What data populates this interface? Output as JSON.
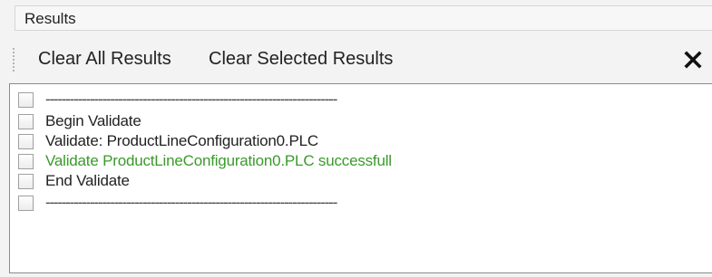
{
  "panel": {
    "title": "Results"
  },
  "toolbar": {
    "clear_all_label": "Clear All Results",
    "clear_selected_label": "Clear Selected Results",
    "close_icon": "close-icon"
  },
  "results": [
    {
      "text": "------------------------------------------------------------------------",
      "kind": "separator",
      "checked": false
    },
    {
      "text": "Begin Validate",
      "kind": "normal",
      "checked": false
    },
    {
      "text": "Validate: ProductLineConfiguration0.PLC",
      "kind": "normal",
      "checked": false
    },
    {
      "text": "Validate ProductLineConfiguration0.PLC successfull",
      "kind": "success",
      "checked": false
    },
    {
      "text": "End Validate",
      "kind": "normal",
      "checked": false
    },
    {
      "text": "------------------------------------------------------------------------",
      "kind": "separator",
      "checked": false
    }
  ],
  "colors": {
    "success_text": "#3a9a2a",
    "normal_text": "#222222"
  }
}
